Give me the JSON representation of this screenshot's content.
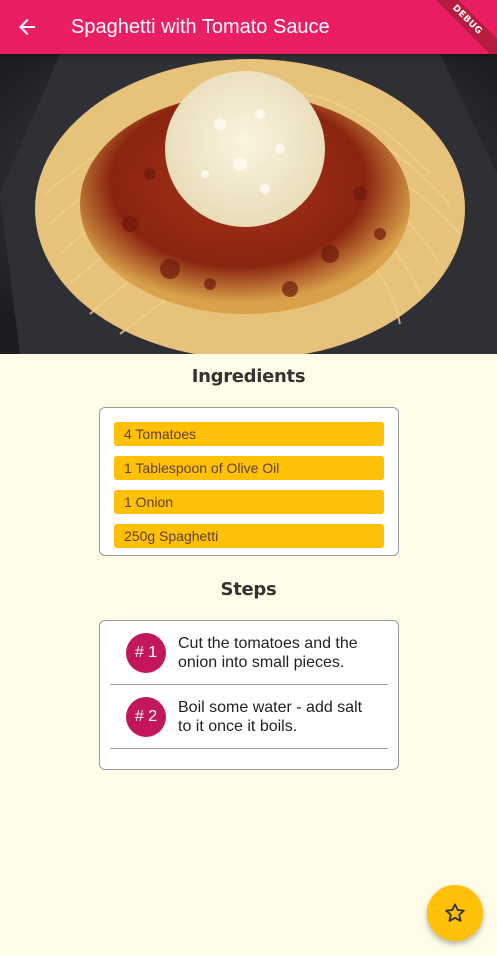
{
  "appbar": {
    "title": "Spaghetti with Tomato Sauce",
    "debug_label": "DEBUG"
  },
  "ingredients": {
    "heading": "Ingredients",
    "items": [
      "4 Tomatoes",
      "1 Tablespoon of Olive Oil",
      "1 Onion",
      "250g Spaghetti"
    ]
  },
  "steps": {
    "heading": "Steps",
    "items": [
      {
        "number": "# 1",
        "text": "Cut the tomatoes and the onion into small pieces."
      },
      {
        "number": "# 2",
        "text": "Boil some water - add salt to it once it boils."
      }
    ]
  },
  "icons": {
    "back": "arrow-back-icon",
    "fab": "star-outline-icon"
  },
  "colors": {
    "appbar": "#e91e63",
    "background": "#fffde7",
    "ingredient_chip": "#ffc107",
    "step_badge": "#c2185b",
    "fab": "#ffc107"
  }
}
